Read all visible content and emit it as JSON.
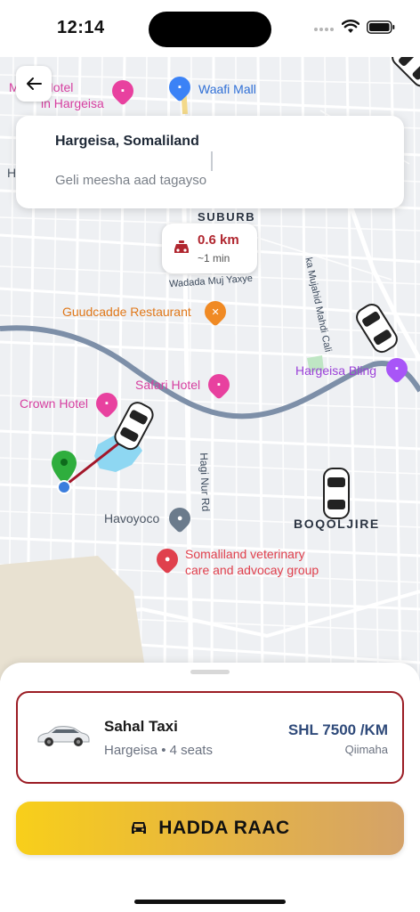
{
  "status_bar": {
    "time": "12:14"
  },
  "search": {
    "origin": "Hargeisa, Somaliland",
    "destination_placeholder": "Geli meesha aad tagayso"
  },
  "distance": {
    "value": "0.6 km",
    "duration": "~1 min"
  },
  "map_labels": {
    "hotel_partial": "M     oor Hotel",
    "hotel_partial_line2": "in Hargeisa",
    "waafi_mall": "Waafi Mall",
    "edge_letter": "H",
    "suburb": "SUBURB",
    "mujahid_street": "ka Mujahid Mahdi Cali",
    "wadada_street": "Wadada Muj Yaxye",
    "guudcadde": "Guudcadde Restaurant",
    "hargeisa_bling": "Hargeisa Bling",
    "safari_hotel": "Safari Hotel",
    "crown_hotel": "Crown Hotel",
    "hagi_nur": "Hagi Nur Rd",
    "havoyoco": "Havoyoco",
    "boqoljire": "BOQOLJIRE",
    "vet_line1": "Somaliland veterinary",
    "vet_line2": "care and advocay group"
  },
  "ride": {
    "name": "Sahal Taxi",
    "meta": "Hargeisa • 4 seats",
    "price": "SHL 7500 /KM",
    "price_label": "Qiimaha"
  },
  "book_button": {
    "label": "HADDA RAAC"
  },
  "colors": {
    "accent_red": "#9b1c24",
    "price_blue": "#2f4a7a",
    "button_start": "#f8cf1a",
    "button_end": "#d4a269"
  },
  "icons": [
    "back-arrow-icon",
    "wifi-icon",
    "battery-icon",
    "taxi-icon",
    "car-icon",
    "location-pin-icon"
  ]
}
